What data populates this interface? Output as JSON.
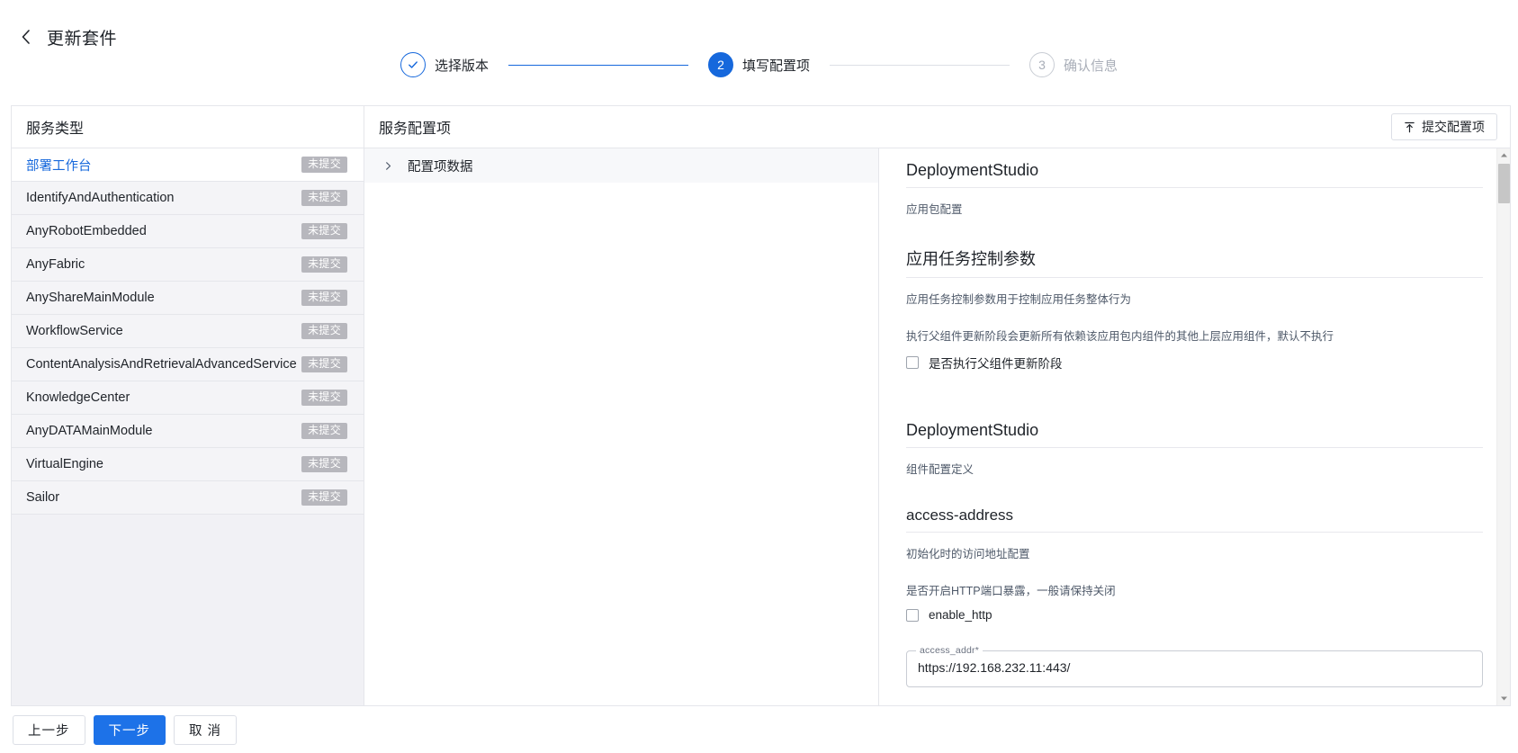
{
  "header": {
    "back_icon": "chevron-left-icon",
    "title": "更新套件"
  },
  "stepper": {
    "steps": [
      {
        "indicator": "✓",
        "label": "选择版本",
        "state": "done"
      },
      {
        "indicator": "2",
        "label": "填写配置项",
        "state": "active"
      },
      {
        "indicator": "3",
        "label": "确认信息",
        "state": "todo"
      }
    ]
  },
  "service_panel": {
    "title": "服务类型",
    "items": [
      {
        "name": "部署工作台",
        "status": "未提交",
        "selected": true
      },
      {
        "name": "IdentifyAndAuthentication",
        "status": "未提交",
        "selected": false
      },
      {
        "name": "AnyRobotEmbedded",
        "status": "未提交",
        "selected": false
      },
      {
        "name": "AnyFabric",
        "status": "未提交",
        "selected": false
      },
      {
        "name": "AnyShareMainModule",
        "status": "未提交",
        "selected": false
      },
      {
        "name": "WorkflowService",
        "status": "未提交",
        "selected": false
      },
      {
        "name": "ContentAnalysisAndRetrievalAdvancedService",
        "status": "未提交",
        "selected": false
      },
      {
        "name": "KnowledgeCenter",
        "status": "未提交",
        "selected": false
      },
      {
        "name": "AnyDATAMainModule",
        "status": "未提交",
        "selected": false
      },
      {
        "name": "VirtualEngine",
        "status": "未提交",
        "selected": false
      },
      {
        "name": "Sailor",
        "status": "未提交",
        "selected": false
      }
    ]
  },
  "config_panel": {
    "title": "服务配置项",
    "submit_button": {
      "label": "提交配置项",
      "icon": "upload-icon"
    },
    "tree": {
      "caret_icon": "chevron-right-icon",
      "root_label": "配置项数据"
    },
    "sections": [
      {
        "heading": "DeploymentStudio",
        "description": "应用包配置"
      },
      {
        "heading": "应用任务控制参数",
        "description": "应用任务控制参数用于控制应用任务整体行为",
        "field_hint": "执行父组件更新阶段会更新所有依赖该应用包内组件的其他上层应用组件，默认不执行",
        "checkbox_label": "是否执行父组件更新阶段",
        "checkbox_checked": false
      },
      {
        "heading": "DeploymentStudio",
        "description": "组件配置定义"
      },
      {
        "heading": "access-address",
        "description": "初始化时的访问地址配置",
        "field_hint": "是否开启HTTP端口暴露，一般请保持关闭",
        "checkbox_label": "enable_http",
        "checkbox_checked": false,
        "input_label": "access_addr",
        "input_required_mark": "*",
        "input_value": "https://192.168.232.11:443/"
      }
    ],
    "scrollbar": {
      "up_icon": "scroll-up-arrow-icon",
      "down_icon": "scroll-down-arrow-icon"
    }
  },
  "footer": {
    "prev_label": "上一步",
    "next_label": "下一步",
    "cancel_label": "取 消"
  },
  "colors": {
    "primary": "#1668dc",
    "primary_button": "#1d72e8",
    "badge_bg": "#b7b7bd",
    "panel_bg": "#f1f1f5"
  }
}
